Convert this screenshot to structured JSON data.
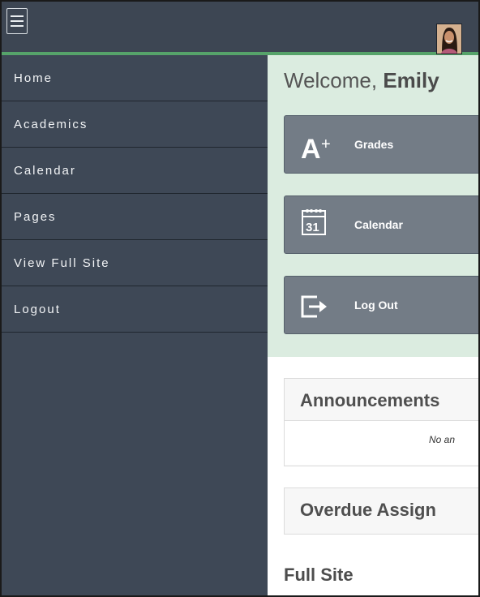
{
  "header": {
    "menu_icon": "hamburger-menu-icon",
    "avatar": "user-avatar",
    "accent_color": "#56a36a",
    "bar_color": "#3d4653"
  },
  "sidebar": {
    "items": [
      {
        "label": "Home"
      },
      {
        "label": "Academics"
      },
      {
        "label": "Calendar"
      },
      {
        "label": "Pages"
      },
      {
        "label": "View Full Site"
      },
      {
        "label": "Logout"
      }
    ]
  },
  "main": {
    "welcome_prefix": "Welcome, ",
    "welcome_name": "Emily",
    "tiles": [
      {
        "label": "Grades",
        "icon": "grades-a-plus-icon"
      },
      {
        "label": "Calendar",
        "icon": "calendar-31-icon"
      },
      {
        "label": "Log Out",
        "icon": "logout-icon"
      }
    ],
    "announcements": {
      "title": "Announcements",
      "body": "No an"
    },
    "overdue": {
      "title": "Overdue Assign"
    },
    "full_site": "Full Site"
  }
}
